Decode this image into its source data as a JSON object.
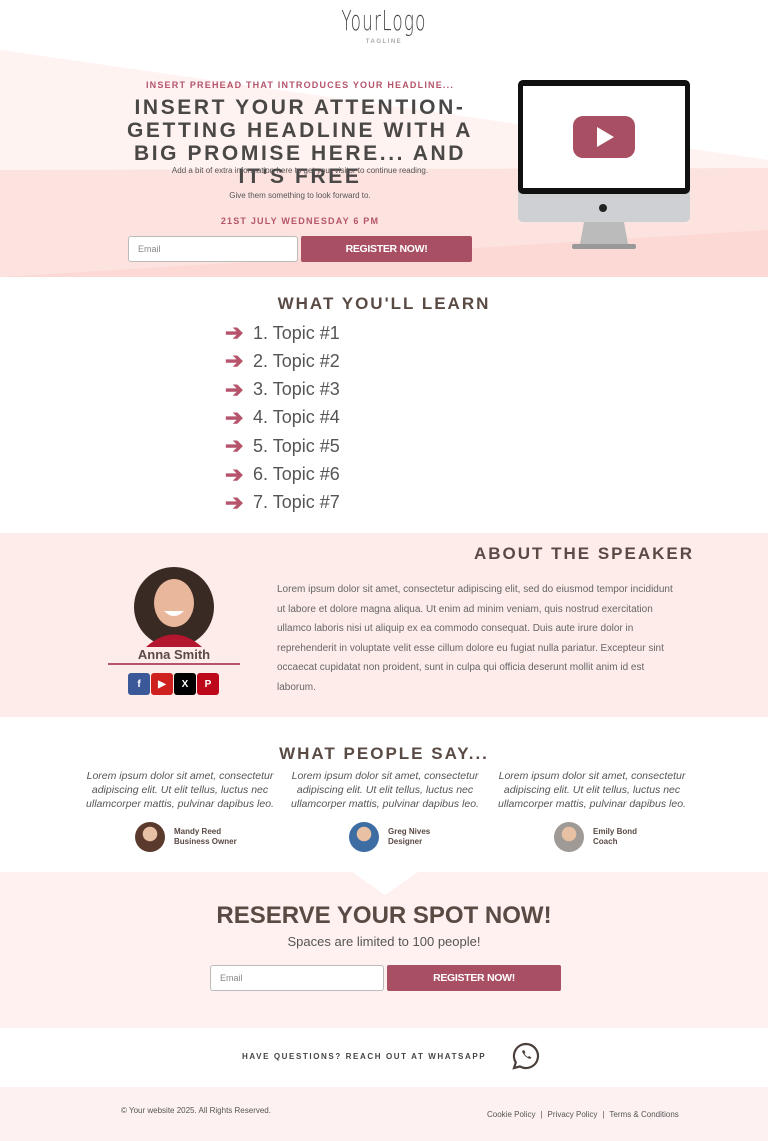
{
  "header": {
    "logo": "YourLogo",
    "tagline": "TAGLINE"
  },
  "hero": {
    "prehead": "INSERT PREHEAD THAT INTRODUCES YOUR HEADLINE...",
    "headline": "INSERT YOUR ATTENTION-GETTING HEADLINE WITH A BIG PROMISE HERE... AND IT'S FREE",
    "sub1": "Add a bit of extra information here to get your visitor to continue reading.",
    "sub2": "Give them something to look forward to.",
    "date": "21ST JULY WEDNESDAY 6 PM",
    "email_placeholder": "Email",
    "register_label": "REGISTER NOW!"
  },
  "learn": {
    "title": "WHAT YOU'LL LEARN",
    "topics": [
      "1. Topic #1",
      "2. Topic #2",
      "3. Topic #3",
      "4. Topic #4",
      "5. Topic #5",
      "6. Topic #6",
      "7. Topic #7"
    ]
  },
  "about": {
    "title": "ABOUT THE SPEAKER",
    "name": "Anna Smith",
    "bio": "Lorem ipsum dolor sit amet, consectetur adipiscing elit, sed do eiusmod tempor incididunt ut labore et dolore magna aliqua. Ut enim ad minim veniam, quis nostrud exercitation ullamco laboris nisi ut aliquip ex ea commodo consequat. Duis aute irure dolor in reprehenderit in voluptate velit esse cillum dolore eu fugiat nulla pariatur. Excepteur sint occaecat cupidatat non proident, sunt in culpa qui officia deserunt mollit anim id est laborum.",
    "social": [
      {
        "icon": "facebook-icon",
        "color": "#3b5998"
      },
      {
        "icon": "youtube-icon",
        "color": "#cd201f"
      },
      {
        "icon": "x-icon",
        "color": "#000000"
      },
      {
        "icon": "pinterest-icon",
        "color": "#bd081c"
      }
    ]
  },
  "testimonials": {
    "title": "WHAT PEOPLE SAY...",
    "items": [
      {
        "quote": "Lorem ipsum dolor sit amet, consectetur adipiscing elit. Ut elit tellus, luctus nec ullamcorper mattis, pulvinar dapibus leo.",
        "name": "Mandy Reed",
        "role": "Business Owner"
      },
      {
        "quote": "Lorem ipsum dolor sit amet, consectetur adipiscing elit. Ut elit tellus, luctus nec ullamcorper mattis, pulvinar dapibus leo.",
        "name": "Greg Nives",
        "role": "Designer"
      },
      {
        "quote": "Lorem ipsum dolor sit amet, consectetur adipiscing elit. Ut elit tellus, luctus nec ullamcorper mattis, pulvinar dapibus leo.",
        "name": "Emily Bond",
        "role": "Coach"
      }
    ]
  },
  "reserve": {
    "title": "RESERVE YOUR SPOT NOW!",
    "subtitle": "Spaces are limited to 100 people!",
    "email_placeholder": "Email",
    "register_label": "REGISTER NOW!"
  },
  "whatsapp": {
    "text": "HAVE QUESTIONS? REACH OUT AT WHATSAPP",
    "icon": "whatsapp-icon"
  },
  "footer": {
    "copyright": "© Your website 2025. All Rights Reserved.",
    "links": [
      "Cookie Policy",
      "Privacy Policy",
      "Terms & Conditions"
    ]
  },
  "colors": {
    "accent": "#a94f64",
    "hero_bg": "#fde3e0",
    "section_bg": "#fdecea"
  }
}
